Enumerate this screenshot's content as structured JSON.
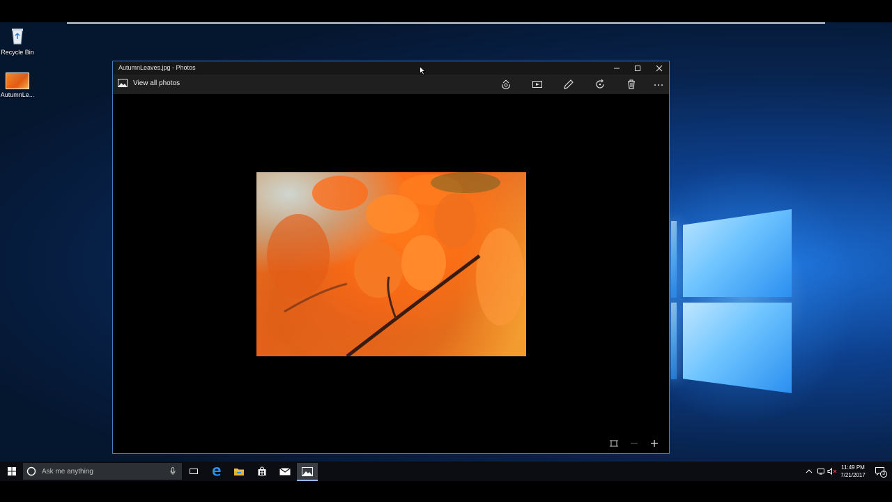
{
  "desktop": {
    "icons": [
      {
        "label": "Recycle Bin"
      },
      {
        "label": "AutumnLe..."
      }
    ]
  },
  "window": {
    "title": "AutumnLeaves.jpg - Photos",
    "controls": [
      "minimize-icon",
      "maximize-icon",
      "close-icon"
    ]
  },
  "toolbar": {
    "view_all_label": "View all photos",
    "tools": [
      "share-icon",
      "slideshow-icon",
      "edit-pencil-icon",
      "rotate-icon",
      "delete-icon",
      "more-icon"
    ]
  },
  "zoom_controls": [
    "fit-to-window-icon",
    "zoom-out-icon",
    "zoom-in-icon"
  ],
  "taskbar": {
    "search_placeholder": "Ask me anything",
    "apps": [
      "task-view-icon",
      "edge-icon",
      "file-explorer-icon",
      "store-icon",
      "mail-icon",
      "photos-icon"
    ],
    "clock_time": "11:49 PM",
    "clock_date": "7/21/2017",
    "notification_count": "3"
  },
  "colors": {
    "accent": "#4a7ab8",
    "photo_orange": "#f07a22"
  }
}
